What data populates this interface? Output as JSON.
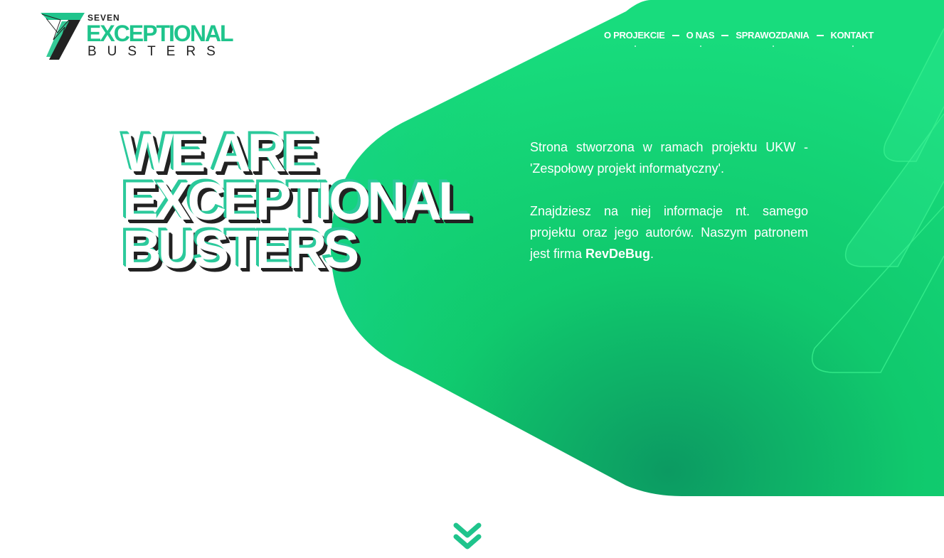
{
  "logo": {
    "line1": "SEVEN",
    "line2": "EXCEPTIONAL",
    "line3": "BUSTERS"
  },
  "nav": {
    "items": [
      {
        "label": "O PROJEKCIE"
      },
      {
        "label": "O NAS"
      },
      {
        "label": "SPRAWOZDANIA"
      },
      {
        "label": "KONTAKT"
      }
    ]
  },
  "hero": {
    "headline_line1": "WE ARE",
    "headline_line2": "EXCEPTIONAL",
    "headline_line3": "BUSTERS",
    "paragraph1": "Strona stworzona w ramach projektu UKW - 'Zespołowy projekt informatyczny'.",
    "paragraph2_prefix": "Znajdziesz na niej informacje nt. samego projektu oraz jego autorów. Naszym patronem jest firma ",
    "paragraph2_brand": "RevDeBug",
    "paragraph2_suffix": "."
  },
  "icons": {
    "logo_mark": "seven-logo-mark-icon",
    "scroll": "double-chevron-down-icon"
  },
  "colors": {
    "accent": "#1fc48c",
    "hero_green_light": "#13d86e",
    "hero_green_dark": "#0c9e63",
    "text_dark": "#222222",
    "shadow_teal": "#2bc99b"
  }
}
